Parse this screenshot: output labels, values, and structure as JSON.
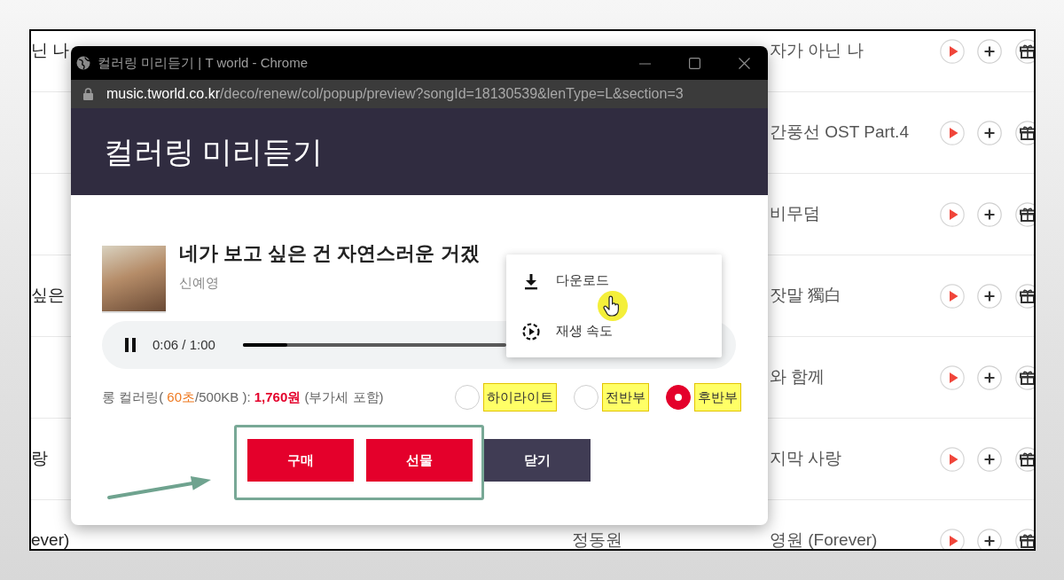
{
  "background_list": {
    "rows": [
      {
        "column_1": "닌 나",
        "column_3": "자가 아닌 나"
      },
      {
        "column_3": "간풍선 OST Part.4"
      },
      {
        "column_3": "비무덤"
      },
      {
        "column_1": "싶은",
        "column_3": "잣말 獨白"
      },
      {
        "column_3": "와 함께"
      },
      {
        "column_1": "랑",
        "column_3": "지막 사랑"
      },
      {
        "column_1": "ever)",
        "column_2": "정동원",
        "column_3": "영원 (Forever)"
      }
    ]
  },
  "popup_window": {
    "title": "컬러링 미리듣기 | T world - Chrome",
    "url_host": "music.tworld.co.kr",
    "url_path": "/deco/renew/col/popup/preview?songId=18130539&lenType=L&section=3",
    "header": "컬러링 미리듣기",
    "song": {
      "title": "네가 보고 싶은 건 자연스러운 거겠",
      "artist": "신예영"
    },
    "player": {
      "playing": true,
      "time": "0:06 / 1:00",
      "level": 0.17
    },
    "price_info": {
      "label": "롱 컬러링(",
      "duration": "60초",
      "size": "/500KB ):",
      "price": "1,760원",
      "vat_note": "(부가세 포함)"
    },
    "sections": [
      {
        "label": "하이라이트",
        "selected": false,
        "highlighted": true
      },
      {
        "label": "전반부",
        "selected": false,
        "highlighted": true
      },
      {
        "label": "후반부",
        "selected": true,
        "highlighted": true
      }
    ],
    "buttons": [
      {
        "label": "구매",
        "kind": "primary",
        "framed": true
      },
      {
        "label": "선물",
        "kind": "primary",
        "framed": true
      },
      {
        "label": "닫기",
        "kind": "secondary",
        "framed": false
      }
    ],
    "context_menu": {
      "items": [
        {
          "label": "다운로드",
          "kind": "download"
        },
        {
          "label": "재생 속도",
          "kind": "speed"
        }
      ]
    },
    "cursor": {
      "kind": "hand"
    },
    "annotation_arrow": true
  }
}
